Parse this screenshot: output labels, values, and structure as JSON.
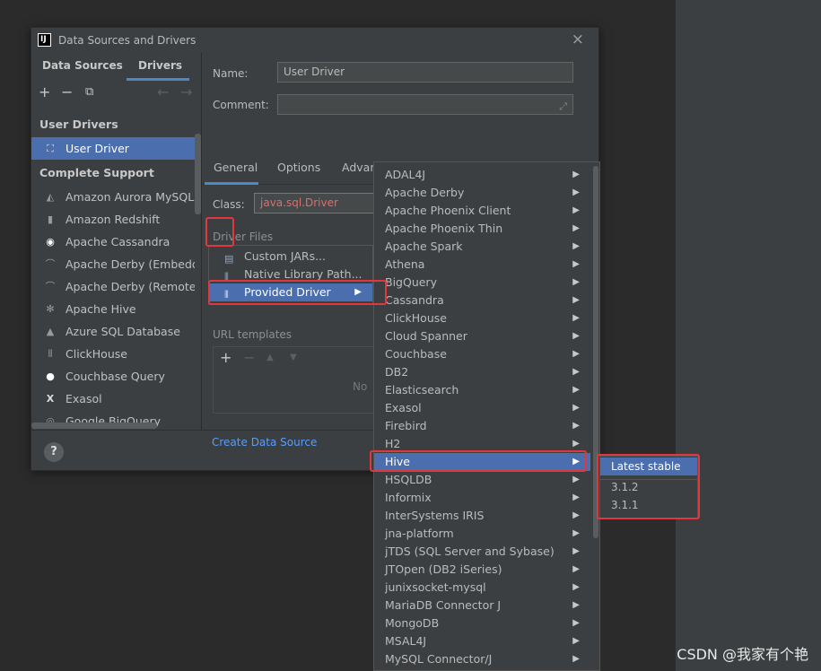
{
  "dialog": {
    "title": "Data Sources and Drivers",
    "close_glyph": "×",
    "help_glyph": "?"
  },
  "left": {
    "tabs": [
      "Data Sources",
      "Drivers"
    ],
    "active_tab": "Drivers",
    "toolbar": {
      "add": "+",
      "remove": "−",
      "copy": "⧉",
      "back": "←",
      "forward": "→"
    },
    "user_drivers_header": "User Drivers",
    "user_drivers": [
      {
        "label": "User Driver",
        "icon": "driver-icon"
      }
    ],
    "complete_support_header": "Complete Support",
    "complete_support": [
      {
        "label": "Amazon Aurora MySQL",
        "icon": "aurora-icon"
      },
      {
        "label": "Amazon Redshift",
        "icon": "redshift-icon"
      },
      {
        "label": "Apache Cassandra",
        "icon": "cassandra-icon"
      },
      {
        "label": "Apache Derby (Embedded)",
        "icon": "derby-icon"
      },
      {
        "label": "Apache Derby (Remote)",
        "icon": "derby-icon"
      },
      {
        "label": "Apache Hive",
        "icon": "hive-icon"
      },
      {
        "label": "Azure SQL Database",
        "icon": "azure-icon"
      },
      {
        "label": "ClickHouse",
        "icon": "clickhouse-icon"
      },
      {
        "label": "Couchbase Query",
        "icon": "couchbase-icon"
      },
      {
        "label": "Exasol",
        "icon": "exasol-icon"
      },
      {
        "label": "Google BigQuery",
        "icon": "bigquery-icon"
      }
    ]
  },
  "right": {
    "name_label": "Name:",
    "name_value": "User Driver",
    "comment_label": "Comment:",
    "comment_value": "",
    "tabs": [
      "General",
      "Options",
      "Advanced"
    ],
    "active_tab": "General",
    "class_label": "Class:",
    "class_value": "java.sql.Driver",
    "driver_files_label": "Driver Files",
    "url_templates_label": "URL templates",
    "no_text": "No",
    "create_link": "Create Data Source",
    "add_glyph": "+",
    "remove_glyph": "−",
    "up_glyph": "▲",
    "down_glyph": "▼"
  },
  "add_menu": [
    {
      "label": "Custom JARs...",
      "icon": "jar-icon"
    },
    {
      "label": "Native Library Path...",
      "icon": "native-library-icon"
    },
    {
      "label": "Provided Driver",
      "icon": "provided-driver-icon",
      "submenu": true
    }
  ],
  "driver_list": [
    "ADAL4J",
    "Apache Derby",
    "Apache Phoenix Client",
    "Apache Phoenix Thin",
    "Apache Spark",
    "Athena",
    "BigQuery",
    "Cassandra",
    "ClickHouse",
    "Cloud Spanner",
    "Couchbase",
    "DB2",
    "Elasticsearch",
    "Exasol",
    "Firebird",
    "H2",
    "Hive",
    "HSQLDB",
    "Informix",
    "InterSystems IRIS",
    "jna-platform",
    "jTDS (SQL Server and Sybase)",
    "JTOpen (DB2 iSeries)",
    "junixsocket-mysql",
    "MariaDB Connector J",
    "MongoDB",
    "MSAL4J",
    "MySQL Connector/J"
  ],
  "driver_list_selected": "Hive",
  "versions": [
    "Latest stable",
    "3.1.2",
    "3.1.1"
  ],
  "versions_selected": "Latest stable",
  "watermark": "CSDN @我家有个艳",
  "colors": {
    "selection": "#4b6eaf",
    "highlight": "#e0383d",
    "link": "#589df6",
    "error_text": "#e06c6c"
  }
}
